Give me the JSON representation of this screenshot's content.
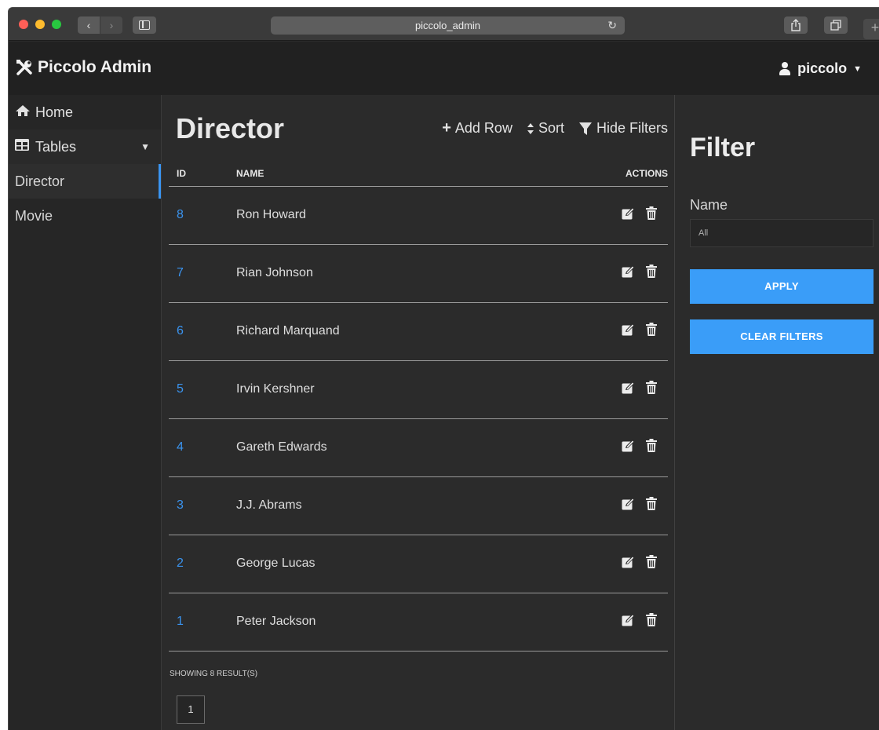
{
  "browser": {
    "url": "piccolo_admin",
    "back_icon": "‹",
    "forward_icon": "›",
    "reload_icon": "↻",
    "new_tab_icon": "+"
  },
  "header": {
    "brand": "Piccolo Admin",
    "user": "piccolo"
  },
  "sidebar": {
    "home": "Home",
    "tables": "Tables",
    "items": [
      {
        "label": "Director"
      },
      {
        "label": "Movie"
      }
    ]
  },
  "main": {
    "title": "Director",
    "toolbar": {
      "add_row": "Add Row",
      "sort": "Sort",
      "hide_filters": "Hide Filters"
    },
    "columns": {
      "id": "ID",
      "name": "NAME",
      "actions": "ACTIONS"
    },
    "rows": [
      {
        "id": "8",
        "name": "Ron Howard"
      },
      {
        "id": "7",
        "name": "Rian Johnson"
      },
      {
        "id": "6",
        "name": "Richard Marquand"
      },
      {
        "id": "5",
        "name": "Irvin Kershner"
      },
      {
        "id": "4",
        "name": "Gareth Edwards"
      },
      {
        "id": "3",
        "name": "J.J. Abrams"
      },
      {
        "id": "2",
        "name": "George Lucas"
      },
      {
        "id": "1",
        "name": "Peter Jackson"
      }
    ],
    "results": "SHOWING 8 RESULT(S)",
    "page": "1"
  },
  "filter": {
    "title": "Filter",
    "name_label": "Name",
    "name_value": "All",
    "apply": "APPLY",
    "clear": "CLEAR FILTERS"
  },
  "colors": {
    "accent": "#3a9df8",
    "link": "#3a94f0",
    "background": "#2b2b2b"
  }
}
